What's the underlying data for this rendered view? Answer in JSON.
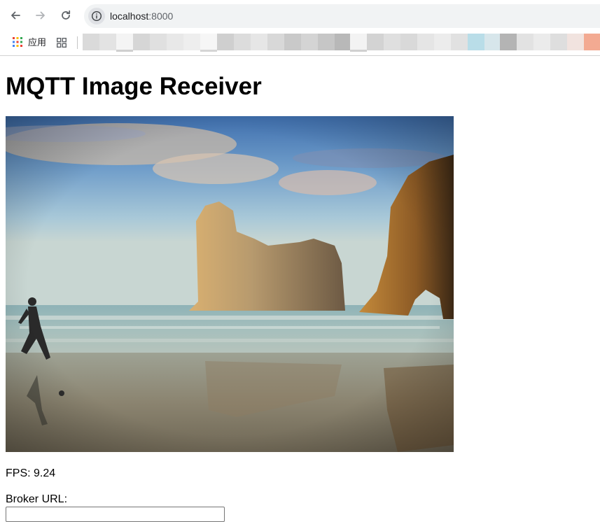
{
  "browser": {
    "url_host": "localhost",
    "url_port": ":8000",
    "icons": {
      "back": "arrow-left-icon",
      "forward": "arrow-right-icon",
      "reload": "reload-icon",
      "site_info": "info-icon",
      "apps": "apps-grid-icon",
      "tab_grid": "tab-grid-icon"
    },
    "bookmarks": {
      "apps_label": "应用"
    }
  },
  "page": {
    "title": "MQTT Image Receiver",
    "fps_text": "FPS: 9.24",
    "broker_label": "Broker URL:",
    "broker_url_value": ""
  },
  "colors": {
    "apps_dots": [
      "#ea4335",
      "#fbbc05",
      "#34a853",
      "#4285f4",
      "#ea4335",
      "#34a853",
      "#4285f4",
      "#fbbc05",
      "#ea4335"
    ]
  }
}
